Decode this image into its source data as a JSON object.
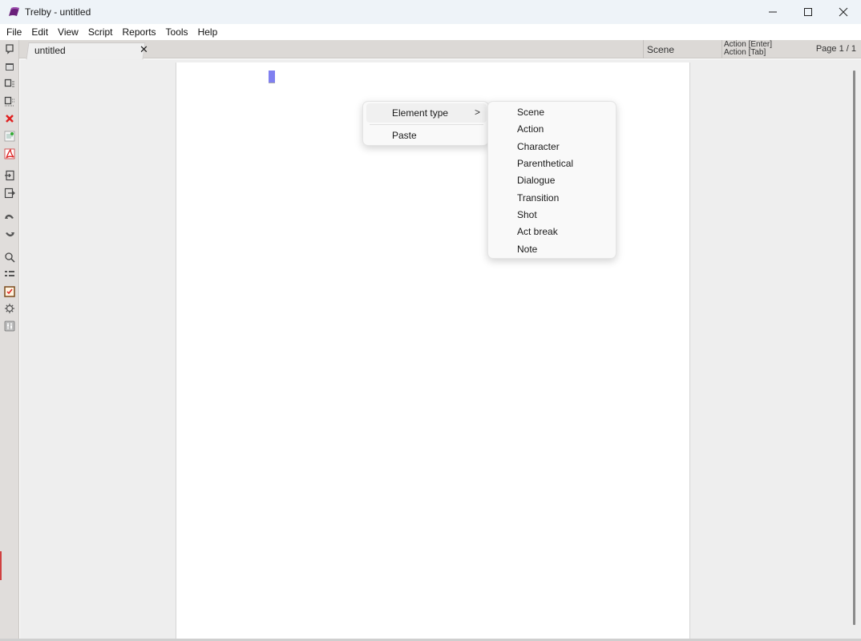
{
  "window": {
    "title": "Trelby - untitled",
    "controls": {
      "minimize": "—",
      "maximize": "☐",
      "close": "✕"
    }
  },
  "menubar": {
    "items": [
      {
        "label": "File"
      },
      {
        "label": "Edit"
      },
      {
        "label": "View"
      },
      {
        "label": "Script"
      },
      {
        "label": "Reports"
      },
      {
        "label": "Tools"
      },
      {
        "label": "Help"
      }
    ]
  },
  "tabs": [
    {
      "label": "untitled",
      "close": "✕",
      "active": true
    }
  ],
  "status": {
    "element": "Scene",
    "enter_action": "Action [Enter]",
    "tab_action": "Action [Tab]",
    "page": "Page 1 / 1"
  },
  "toolbar": {
    "items": [
      {
        "icon": "new-document-icon"
      },
      {
        "icon": "open-folder-icon"
      },
      {
        "icon": "save-icon"
      },
      {
        "icon": "save-as-icon"
      },
      {
        "icon": "close-icon"
      },
      {
        "icon": "import-script-icon"
      },
      {
        "icon": "pdf-icon"
      },
      {
        "icon": "import-icon"
      },
      {
        "icon": "export-icon"
      },
      {
        "icon": "undo-icon"
      },
      {
        "icon": "redo-icon"
      },
      {
        "icon": "find-icon"
      },
      {
        "icon": "list-icon"
      },
      {
        "icon": "spell-check-icon"
      },
      {
        "icon": "settings-icon"
      },
      {
        "icon": "script-settings-icon"
      }
    ]
  },
  "context_menu": {
    "items": [
      {
        "label": "Element type",
        "submenu_arrow": ">"
      },
      {
        "label": "Paste"
      }
    ],
    "submenu": {
      "items": [
        {
          "label": "Scene"
        },
        {
          "label": "Action"
        },
        {
          "label": "Character"
        },
        {
          "label": "Parenthetical"
        },
        {
          "label": "Dialogue"
        },
        {
          "label": "Transition"
        },
        {
          "label": "Shot"
        },
        {
          "label": "Act break"
        },
        {
          "label": "Note"
        }
      ]
    }
  },
  "colors": {
    "cursor": "#8080f0",
    "app_icon": "#6a1f7a",
    "close_tool": "#e02020"
  }
}
